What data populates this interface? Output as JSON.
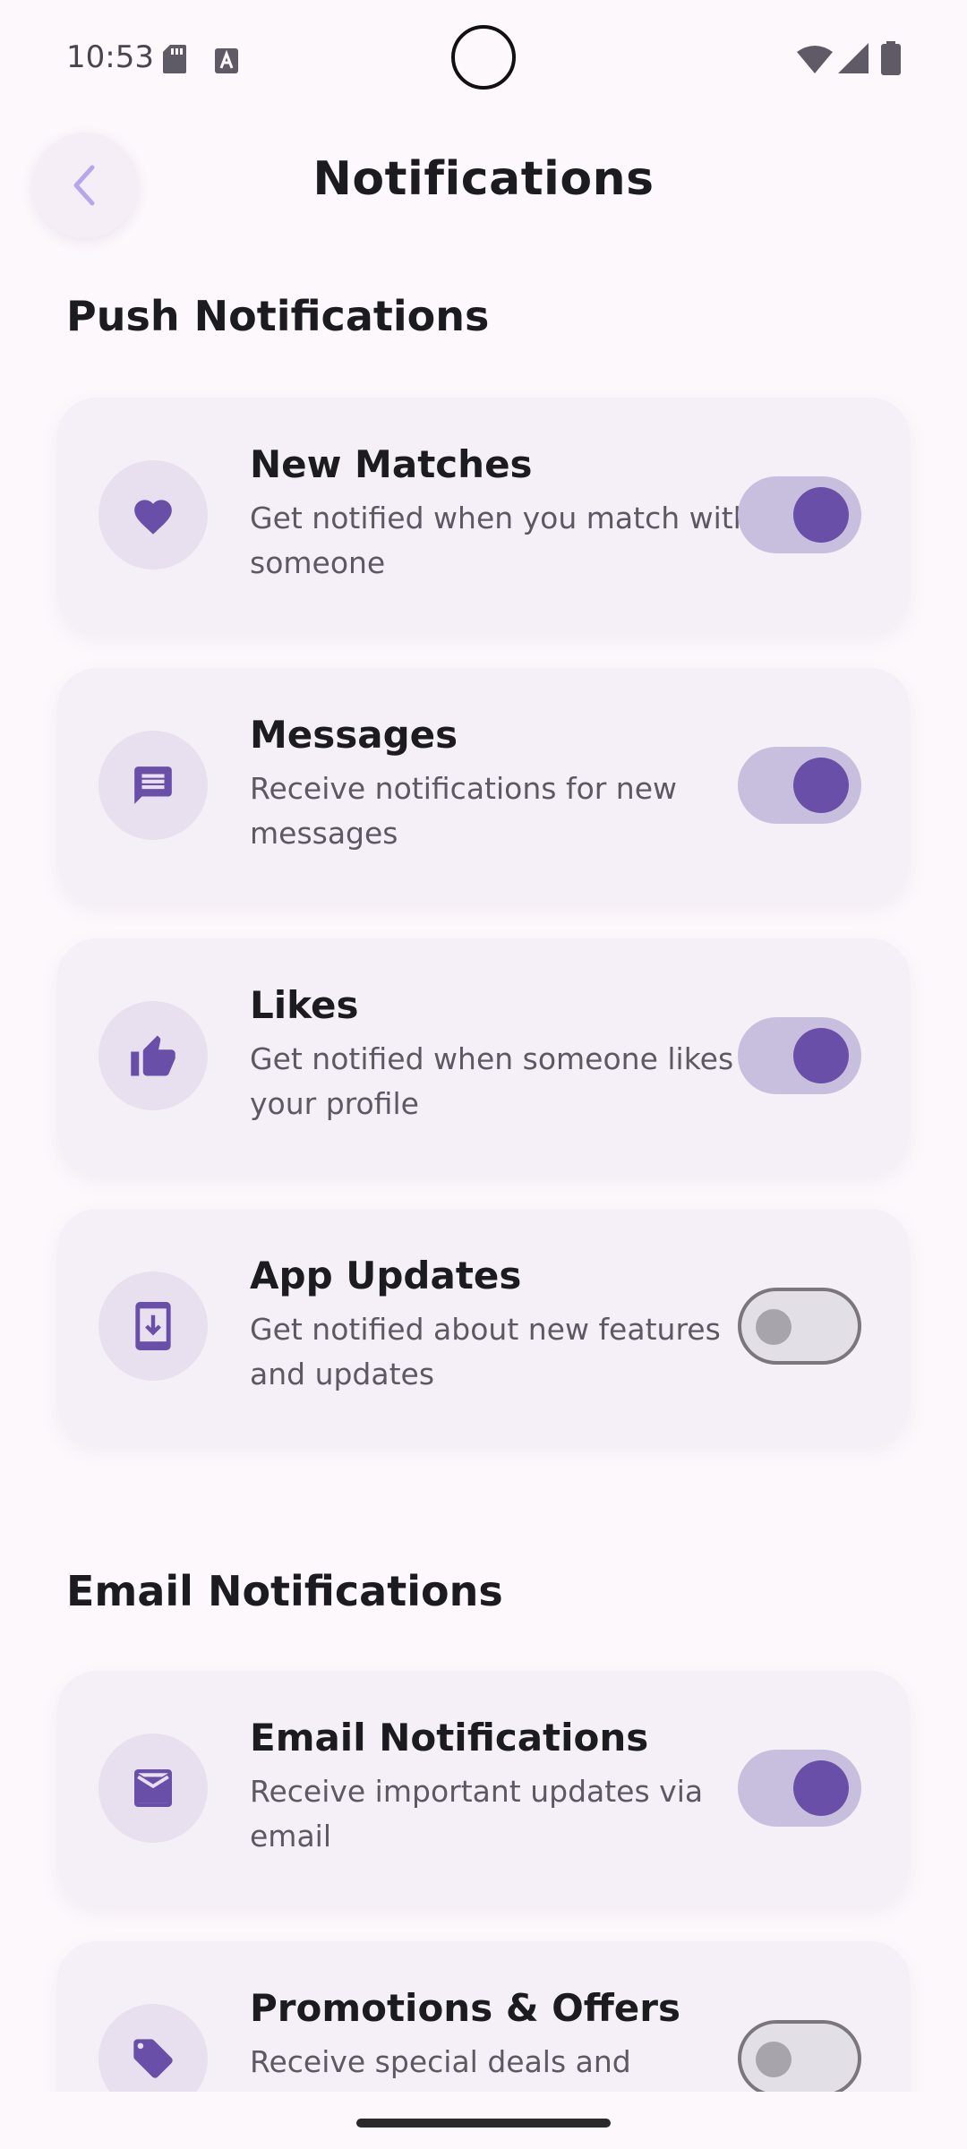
{
  "status_bar": {
    "time": "10:53",
    "icons": [
      "sd-card-icon",
      "text-a-icon",
      "wifi-icon",
      "signal-icon",
      "battery-icon"
    ]
  },
  "app_bar": {
    "title": "Notifications",
    "back_icon": "chevron-left-icon"
  },
  "sections": {
    "push": {
      "title": "Push Notifications",
      "items": [
        {
          "title": "New Matches",
          "description": "Get notified when you match with someone",
          "icon": "heart-icon",
          "enabled": true
        },
        {
          "title": "Messages",
          "description": "Receive notifications for new messages",
          "icon": "message-icon",
          "enabled": true
        },
        {
          "title": "Likes",
          "description": "Get notified when someone likes your profile",
          "icon": "thumbs-up-icon",
          "enabled": true
        },
        {
          "title": "App Updates",
          "description": "Get notified about new features and updates",
          "icon": "system-update-icon",
          "enabled": false
        }
      ]
    },
    "email": {
      "title": "Email Notifications",
      "items": [
        {
          "title": "Email Notifications",
          "description": "Receive important updates via email",
          "icon": "mail-icon",
          "enabled": true
        },
        {
          "title": "Promotions & Offers",
          "description": "Receive special deals and",
          "icon": "tag-icon",
          "enabled": false
        }
      ]
    }
  },
  "colors": {
    "accent": "#6a4fa8",
    "toggle_track_on": "#c8bfde",
    "background": "#fdf8fc",
    "card": "#f5f0f7"
  }
}
